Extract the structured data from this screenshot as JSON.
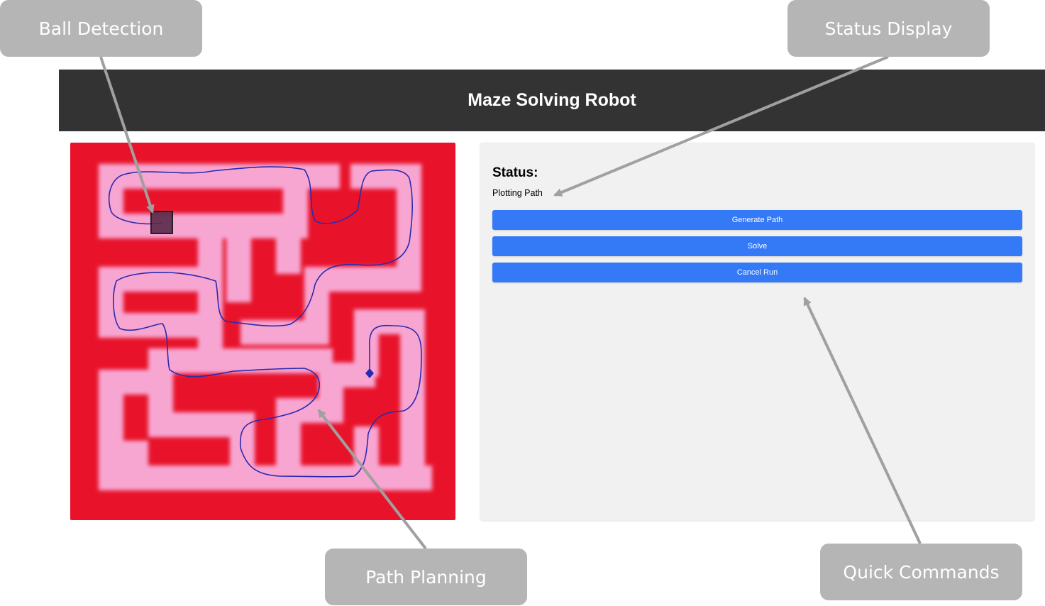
{
  "app": {
    "title": "Maze Solving Robot"
  },
  "status": {
    "label": "Status:",
    "value": "Plotting Path"
  },
  "buttons": {
    "generate_path": "Generate Path",
    "solve": "Solve",
    "cancel_run": "Cancel Run"
  },
  "callouts": {
    "ball_detection": "Ball Detection",
    "status_display": "Status Display",
    "path_planning": "Path Planning",
    "quick_commands": "Quick Commands"
  },
  "colors": {
    "header_bg": "#333333",
    "button_bg": "#3479f6",
    "maze_wall": "#e8132a",
    "maze_corridor": "#f7a6d2",
    "path": "#2a2ab0",
    "callout_bg": "#b5b5b5"
  },
  "icons": {
    "ball_marker": "square-marker-icon",
    "goal_marker": "diamond-marker-icon"
  }
}
